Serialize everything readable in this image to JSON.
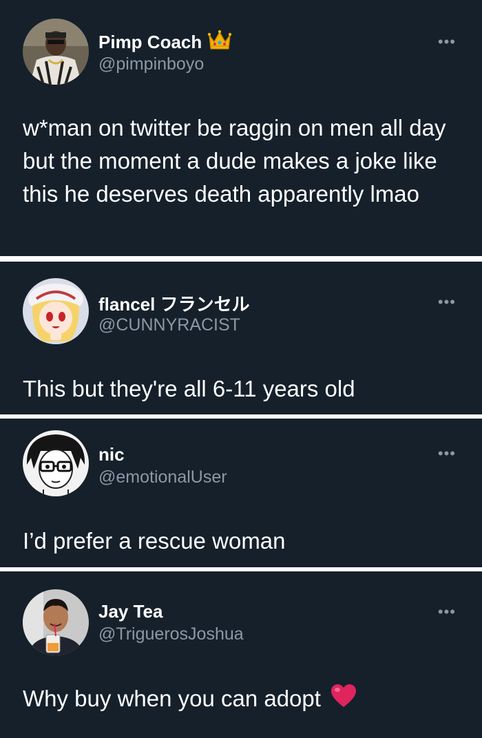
{
  "tweets": [
    {
      "name": "Pimp Coach",
      "badge": "crown-emoji",
      "handle": "@pimpinboyo",
      "text": "w*man on twitter be raggin on men all day but the moment a dude makes a joke like this he deserves death apparently lmao",
      "more": "•••"
    },
    {
      "name": "flancel フランセル",
      "handle": "@CUNNYRACIST",
      "text": "This but they're all 6-11 years old",
      "more": "•••"
    },
    {
      "name": "nic",
      "handle": "@emotionalUser",
      "text": "I’d prefer a rescue woman",
      "more": "•••"
    },
    {
      "name": "Jay Tea",
      "handle": "@TriguerosJoshua",
      "text": "Why buy when you can adopt",
      "emoji": "red-heart-emoji",
      "more": "•••"
    }
  ],
  "colors": {
    "background": "#15202b",
    "text": "#ffffff",
    "secondary": "#8b98a5",
    "divider": "#ffffff",
    "heart": "#e0245e"
  }
}
